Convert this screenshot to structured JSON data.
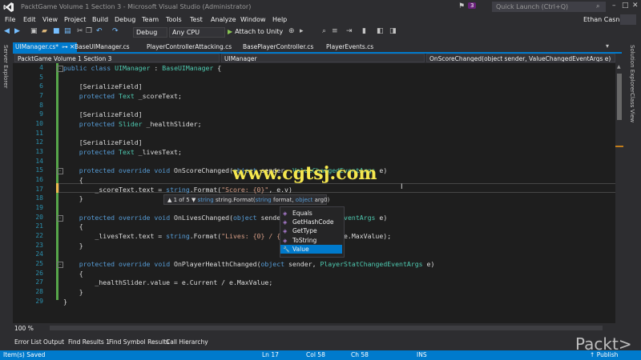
{
  "title_bar": {
    "title": "PacktGame Volume 1 Section 3 - Microsoft Visual Studio (Administrator)",
    "notification_count": "3",
    "quick_launch_placeholder": "Quick Launch (Ctrl+Q)"
  },
  "menu": [
    "File",
    "Edit",
    "View",
    "Project",
    "Build",
    "Debug",
    "Team",
    "Tools",
    "Test",
    "Analyze",
    "Window",
    "Help"
  ],
  "user": {
    "name": "Ethan Casner"
  },
  "toolbar": {
    "config": "Debug",
    "platform": "Any CPU",
    "attach_label": "Attach to Unity"
  },
  "side_panels": {
    "left": "Server Explorer",
    "right_1": "Solution Explorer",
    "right_2": "Class View"
  },
  "tabs": [
    {
      "label": "UIManager.cs*",
      "active": true
    },
    {
      "label": "BaseUIManager.cs",
      "active": false
    },
    {
      "label": "PlayerControllerAttacking.cs",
      "active": false
    },
    {
      "label": "BasePlayerController.cs",
      "active": false
    },
    {
      "label": "PlayerEvents.cs",
      "active": false
    }
  ],
  "navbar": {
    "project": "PacktGame Volume 1 Section 3",
    "class": "UIManager",
    "member": "OnScoreChanged(object sender, ValueChangedEventArgs e)"
  },
  "code_lines": [
    {
      "n": "4",
      "t": "public class UIManager : BaseUIManager {"
    },
    {
      "n": "5",
      "t": ""
    },
    {
      "n": "6",
      "t": "    [SerializeField]"
    },
    {
      "n": "7",
      "t": "    protected Text _scoreText;"
    },
    {
      "n": "8",
      "t": ""
    },
    {
      "n": "9",
      "t": "    [SerializeField]"
    },
    {
      "n": "10",
      "t": "    protected Slider _healthSlider;"
    },
    {
      "n": "11",
      "t": ""
    },
    {
      "n": "12",
      "t": "    [SerializeField]"
    },
    {
      "n": "13",
      "t": "    protected Text _livesText;"
    },
    {
      "n": "14",
      "t": ""
    },
    {
      "n": "15",
      "t": "    protected override void OnScoreChanged(object sender, ValueChangedEventArgs e)"
    },
    {
      "n": "16",
      "t": "    {"
    },
    {
      "n": "17",
      "t": "        _scoreText.text = string.Format(\"Score: {0}\", e.v)"
    },
    {
      "n": "18",
      "t": "    }"
    },
    {
      "n": "19",
      "t": ""
    },
    {
      "n": "20",
      "t": "    protected override void OnLivesChanged(object sender, ValueChangedEventArgs e)"
    },
    {
      "n": "21",
      "t": "    {"
    },
    {
      "n": "22",
      "t": "        _livesText.text = string.Format(\"Lives: {0} / {1}\", e.Current, e.MaxValue);"
    },
    {
      "n": "23",
      "t": "    }"
    },
    {
      "n": "24",
      "t": ""
    },
    {
      "n": "25",
      "t": "    protected override void OnPlayerHealthChanged(object sender, PlayerStatChangedEventArgs e)"
    },
    {
      "n": "26",
      "t": "    {"
    },
    {
      "n": "27",
      "t": "        _healthSlider.value = e.Current / e.MaxValue;"
    },
    {
      "n": "28",
      "t": "    }"
    },
    {
      "n": "29",
      "t": "}"
    }
  ],
  "watermark": "www.cgtsj.com",
  "param_info": {
    "counter": "1 of 5",
    "return_type": "string",
    "signature_prefix": "string.Format(",
    "p1_type": "string",
    "p1_name": " format, ",
    "p2_type": "object",
    "p2_name": " arg0)"
  },
  "intellisense": [
    {
      "label": "Equals",
      "selected": false
    },
    {
      "label": "GetHashCode",
      "selected": false
    },
    {
      "label": "GetType",
      "selected": false
    },
    {
      "label": "ToString",
      "selected": false
    },
    {
      "label": "Value",
      "selected": true
    }
  ],
  "zoom": "100 %",
  "bottom_tabs": [
    "Error List",
    "Output",
    "Find Results 1",
    "Find Symbol Results",
    "Call Hierarchy"
  ],
  "status": {
    "message": "Item(s) Saved",
    "ln": "Ln 17",
    "col": "Col 58",
    "ch": "Ch 58",
    "mode": "INS",
    "publish": "Publish"
  },
  "brand": "Packt>",
  "colors": {
    "accent": "#007acc",
    "background": "#1e1e1e",
    "keyword": "#569cd6",
    "type": "#4ec9b0",
    "string": "#d69d85"
  }
}
